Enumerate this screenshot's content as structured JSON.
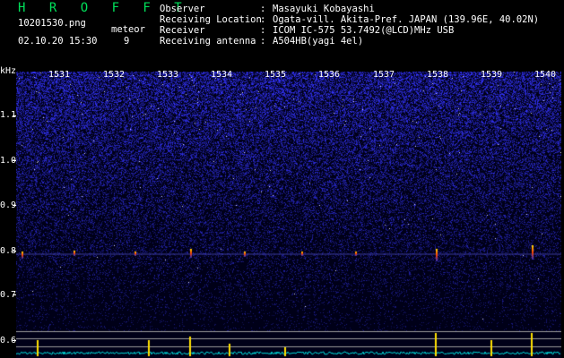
{
  "header": {
    "brand": "H R O F F T",
    "filename": "10201530.png",
    "datetime": "02.10.20 15:30",
    "meteor_label": "meteor",
    "meteor_count": "9",
    "info": [
      {
        "label": "Observer",
        "value": "Masayuki Kobayashi"
      },
      {
        "label": "Receiving Location",
        "value": "Ogata-vill. Akita-Pref. JAPAN (139.96E, 40.02N)"
      },
      {
        "label": "Receiver",
        "value": "ICOM IC-575 53.7492(@LCD)MHz USB"
      },
      {
        "label": "Receiving antenna",
        "value": "A504HB(yagi 4el)"
      }
    ]
  },
  "axis": {
    "unit": "kHz",
    "y_labels": [
      "1.1",
      "1.0",
      "0.9",
      "0.8",
      "0.7",
      "0.6"
    ],
    "time_labels": [
      "1531",
      "1532",
      "1533",
      "1534",
      "1535",
      "1536",
      "1537",
      "1538",
      "1539",
      "1540"
    ]
  },
  "colors": {
    "noise_bg": "#000030",
    "noise_hi": "#2a2aa0",
    "trace": "#00e0e0",
    "meteor": "#ffe000",
    "grid_line": "#9a9a9a"
  }
}
